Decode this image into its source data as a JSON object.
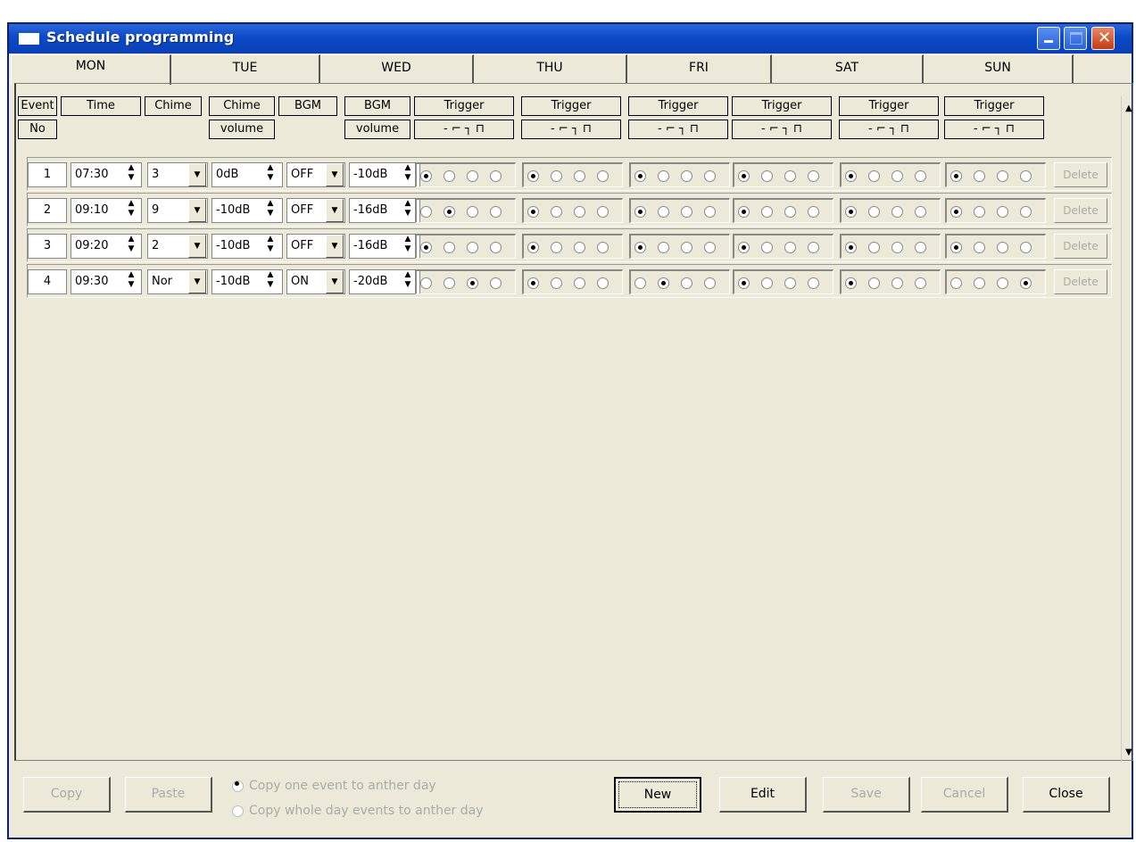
{
  "window": {
    "title": "Schedule programming"
  },
  "tabs": [
    "MON",
    "TUE",
    "WED",
    "THU",
    "FRI",
    "SAT",
    "SUN"
  ],
  "header": {
    "event": "Event",
    "no": "No",
    "time": "Time",
    "chime": "Chime",
    "chime2": "Chime",
    "volume": "volume",
    "bgm": "BGM",
    "bgm2": "BGM",
    "volume2": "volume",
    "trigger": "Trigger",
    "trigger_symbols": "- ⌐ ┐ ⊓"
  },
  "rows": [
    {
      "no": "1",
      "time": "07:30",
      "chime": "3",
      "chime_vol": "0dB",
      "bgm": "OFF",
      "bgm_vol": "-10dB",
      "triggers": [
        0,
        0,
        0,
        0,
        0,
        0
      ],
      "delete": "Delete"
    },
    {
      "no": "2",
      "time": "09:10",
      "chime": "9",
      "chime_vol": "-10dB",
      "bgm": "OFF",
      "bgm_vol": "-16dB",
      "triggers": [
        1,
        0,
        0,
        0,
        0,
        0
      ],
      "delete": "Delete"
    },
    {
      "no": "3",
      "time": "09:20",
      "chime": "2",
      "chime_vol": "-10dB",
      "bgm": "OFF",
      "bgm_vol": "-16dB",
      "triggers": [
        0,
        0,
        0,
        0,
        0,
        0
      ],
      "delete": "Delete"
    },
    {
      "no": "4",
      "time": "09:30",
      "chime": "Nor",
      "chime_vol": "-10dB",
      "bgm": "ON",
      "bgm_vol": "-20dB",
      "triggers": [
        2,
        0,
        1,
        0,
        0,
        3
      ],
      "delete": "Delete"
    }
  ],
  "buttons": {
    "copy": "Copy",
    "paste": "Paste",
    "new": "New",
    "edit": "Edit",
    "save": "Save",
    "cancel": "Cancel",
    "close": "Close"
  },
  "options": {
    "copy_one": "Copy one event to anther day",
    "copy_whole": "Copy whole day events to anther day"
  }
}
